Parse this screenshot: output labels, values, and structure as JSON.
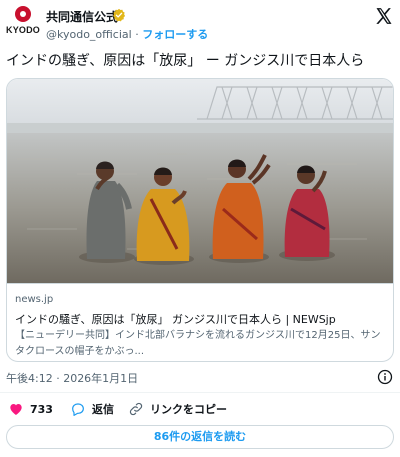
{
  "account": {
    "logo_text": "KYODO",
    "name": "共同通信公式",
    "handle": "@kyodo_official",
    "separator": "·",
    "follow_label": "フォローする"
  },
  "tweet": {
    "text": "インドの騒ぎ、原因は「放尿」 ー ガンジス川で日本人ら"
  },
  "card": {
    "domain": "news.jp",
    "title": "インドの騒ぎ、原因は「放尿」 ガンジス川で日本人ら | NEWSjp",
    "description": "【ニューデリー共同】インド北部バラナシを流れるガンジス川で12月25日、サンタクロースの帽子をかぶっ..."
  },
  "timestamp": "午後4:12 · 2026年1月1日",
  "actions": {
    "like_count": "733",
    "reply_label": "返信",
    "copy_link_label": "リンクをコピー"
  },
  "read_replies_label": "86件の返信を読む",
  "colors": {
    "accent": "#1d9bf0",
    "like": "#f91880",
    "verified": "#e2b719",
    "brand": "#c8102e"
  }
}
